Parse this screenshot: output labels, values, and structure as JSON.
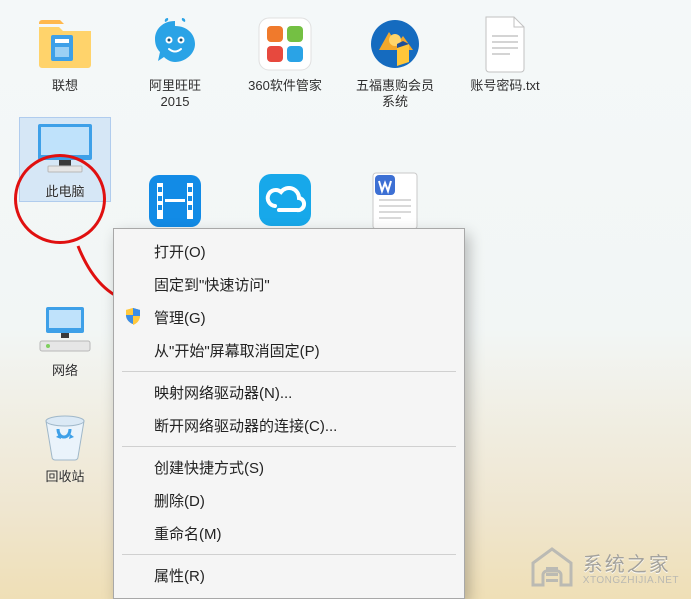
{
  "desktop": {
    "col0": [
      {
        "label": "联想"
      },
      {
        "label": "此电脑",
        "selected": true
      },
      {
        "label": "网络"
      },
      {
        "label": "回收站"
      }
    ],
    "col1": [
      {
        "label": "阿里旺旺\n2015"
      }
    ],
    "col2": [
      {
        "label": "360软件管家"
      }
    ],
    "col3": [
      {
        "label": "五福惠购会员\n系统"
      }
    ],
    "col4": [
      {
        "label": "账号密码.txt"
      }
    ]
  },
  "context_menu": {
    "open": "打开(O)",
    "pin_quick_access": "固定到\"快速访问\"",
    "manage": "管理(G)",
    "unpin_start": "从\"开始\"屏幕取消固定(P)",
    "map_drive": "映射网络驱动器(N)...",
    "disconnect_drive": "断开网络驱动器的连接(C)...",
    "create_shortcut": "创建快捷方式(S)",
    "delete": "删除(D)",
    "rename": "重命名(M)",
    "properties": "属性(R)"
  },
  "watermark": {
    "title": "系统之家",
    "url": "XTONGZHIJIA.NET"
  }
}
